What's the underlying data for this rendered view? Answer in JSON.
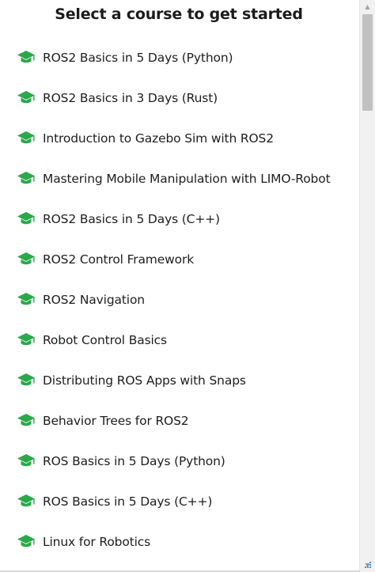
{
  "panel": {
    "title": "Select a course to get started"
  },
  "theme": {
    "icon_color": "#2aa84a",
    "text_color": "#1e1e1e"
  },
  "courses": [
    {
      "label": "ROS2 Basics in 5 Days (Python)",
      "icon": "graduation-cap-icon"
    },
    {
      "label": "ROS2 Basics in 3 Days (Rust)",
      "icon": "graduation-cap-icon"
    },
    {
      "label": "Introduction to Gazebo Sim with ROS2",
      "icon": "graduation-cap-icon"
    },
    {
      "label": "Mastering Mobile Manipulation with LIMO-Robot",
      "icon": "graduation-cap-icon"
    },
    {
      "label": "ROS2 Basics in 5 Days (C++)",
      "icon": "graduation-cap-icon"
    },
    {
      "label": "ROS2 Control Framework",
      "icon": "graduation-cap-icon"
    },
    {
      "label": "ROS2 Navigation",
      "icon": "graduation-cap-icon"
    },
    {
      "label": "Robot Control Basics",
      "icon": "graduation-cap-icon"
    },
    {
      "label": "Distributing ROS Apps with Snaps",
      "icon": "graduation-cap-icon"
    },
    {
      "label": "Behavior Trees for ROS2",
      "icon": "graduation-cap-icon"
    },
    {
      "label": "ROS Basics in 5 Days (Python)",
      "icon": "graduation-cap-icon"
    },
    {
      "label": "ROS Basics in 5 Days (C++)",
      "icon": "graduation-cap-icon"
    },
    {
      "label": "Linux for Robotics",
      "icon": "graduation-cap-icon"
    }
  ]
}
